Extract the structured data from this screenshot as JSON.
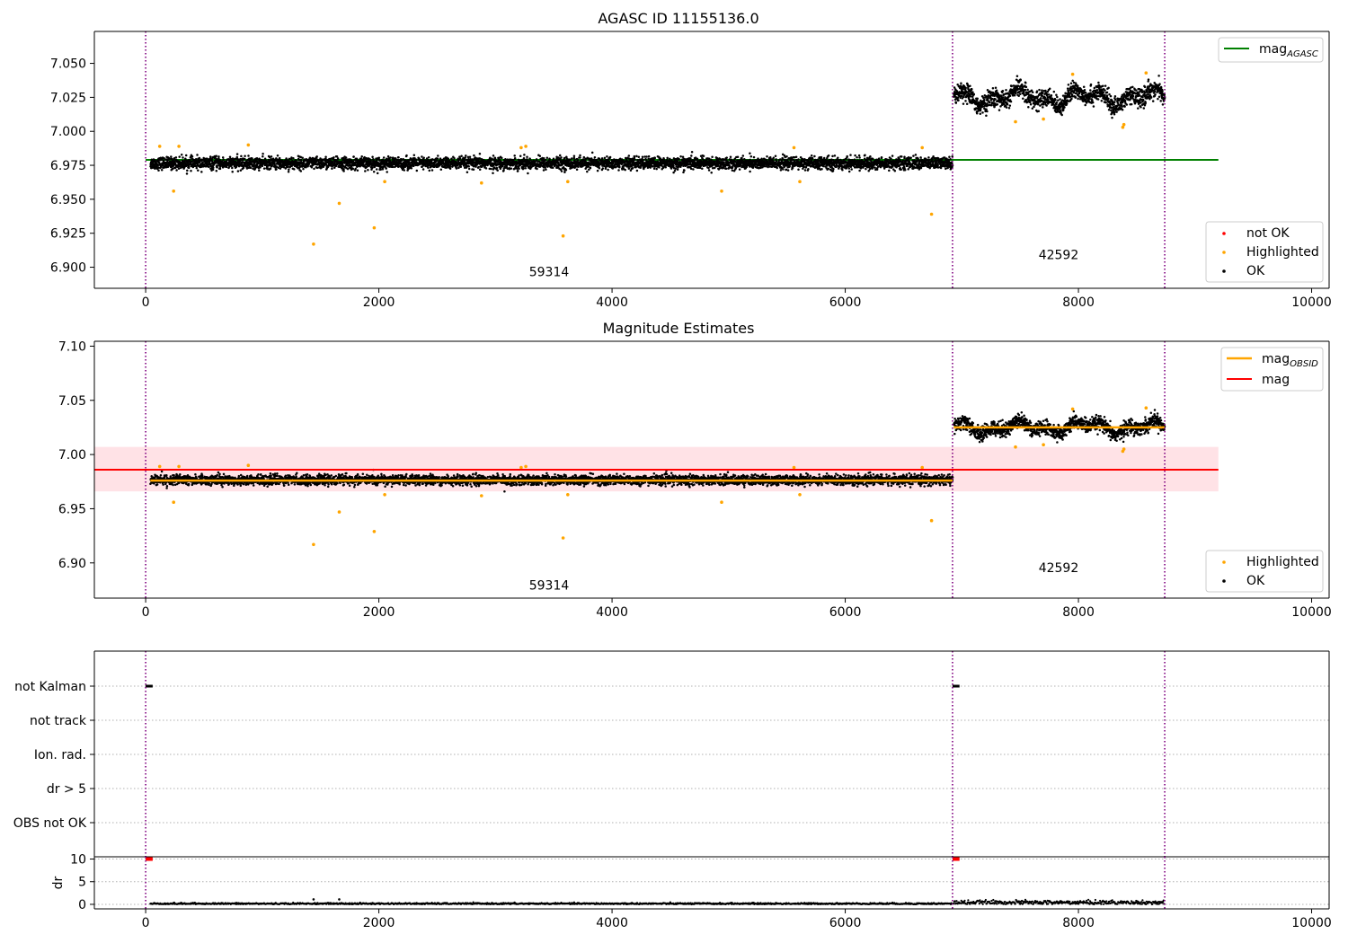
{
  "chart_data": [
    {
      "type": "scatter",
      "title": "AGASC ID 11155136.0",
      "xlim": [
        -440,
        10150
      ],
      "ylim": [
        6.8845,
        7.0735
      ],
      "xticks": [
        0,
        2000,
        4000,
        6000,
        8000,
        10000
      ],
      "yticks": [
        6.9,
        6.925,
        6.95,
        6.975,
        7.0,
        7.025,
        7.05
      ],
      "ytick_labels": [
        "6.900",
        "6.925",
        "6.950",
        "6.975",
        "7.000",
        "7.025",
        "7.050"
      ],
      "obs_boundaries": [
        0,
        6920,
        8740
      ],
      "obs_labels": [
        {
          "text": "59314",
          "x": 3460,
          "y": 6.8935
        },
        {
          "text": "42592",
          "x": 7830,
          "y": 6.906
        }
      ],
      "mag_agasc": {
        "value": 6.979,
        "x_range": [
          0,
          9200
        ]
      },
      "obs_segments": [
        {
          "x_start": 40,
          "x_end": 6920,
          "mean": 6.9765,
          "spread": 0.004
        },
        {
          "x_start": 6930,
          "x_end": 8740,
          "mean": 7.025,
          "spread": 0.006
        }
      ],
      "highlighted": [
        [
          120,
          6.989
        ],
        [
          240,
          6.956
        ],
        [
          285,
          6.989
        ],
        [
          880,
          6.99
        ],
        [
          1440,
          6.917
        ],
        [
          1660,
          6.947
        ],
        [
          1960,
          6.929
        ],
        [
          2050,
          6.963
        ],
        [
          2880,
          6.962
        ],
        [
          3220,
          6.988
        ],
        [
          3260,
          6.989
        ],
        [
          3580,
          6.923
        ],
        [
          3620,
          6.963
        ],
        [
          4940,
          6.956
        ],
        [
          5560,
          6.988
        ],
        [
          5610,
          6.963
        ],
        [
          6660,
          6.988
        ],
        [
          6740,
          6.939
        ],
        [
          7460,
          7.007
        ],
        [
          7700,
          7.009
        ],
        [
          7950,
          7.042
        ],
        [
          8380,
          7.003
        ],
        [
          8390,
          7.005
        ],
        [
          8580,
          7.043
        ]
      ],
      "legend_upper": [
        "mag_AGASC"
      ],
      "legend_lower": [
        "not OK",
        "Highlighted",
        "OK"
      ]
    },
    {
      "type": "scatter",
      "title": "Magnitude Estimates",
      "xlim": [
        -440,
        10150
      ],
      "ylim": [
        6.8675,
        7.1045
      ],
      "xticks": [
        0,
        2000,
        4000,
        6000,
        8000,
        10000
      ],
      "yticks": [
        6.9,
        6.95,
        7.0,
        7.05,
        7.1
      ],
      "ytick_labels": [
        "6.90",
        "6.95",
        "7.00",
        "7.05",
        "7.10"
      ],
      "obs_boundaries": [
        0,
        6920,
        8740
      ],
      "obs_labels": [
        {
          "text": "59314",
          "x": 3460,
          "y": 6.8755
        },
        {
          "text": "42592",
          "x": 7830,
          "y": 6.8915
        }
      ],
      "mag": {
        "value": 6.986,
        "band": [
          6.966,
          7.007
        ],
        "x_range": [
          -440,
          9200
        ]
      },
      "mag_obsid": [
        {
          "x_range": [
            40,
            6920
          ],
          "value": 6.976
        },
        {
          "x_range": [
            6930,
            8740
          ],
          "value": 7.025
        }
      ],
      "obs_segments": [
        {
          "x_start": 40,
          "x_end": 6920,
          "mean": 6.9765,
          "spread": 0.004
        },
        {
          "x_start": 6930,
          "x_end": 8740,
          "mean": 7.025,
          "spread": 0.006
        }
      ],
      "highlighted": [
        [
          120,
          6.989
        ],
        [
          240,
          6.956
        ],
        [
          285,
          6.989
        ],
        [
          880,
          6.99
        ],
        [
          1440,
          6.917
        ],
        [
          1660,
          6.947
        ],
        [
          1960,
          6.929
        ],
        [
          2050,
          6.963
        ],
        [
          2880,
          6.962
        ],
        [
          3220,
          6.988
        ],
        [
          3260,
          6.989
        ],
        [
          3580,
          6.923
        ],
        [
          3620,
          6.963
        ],
        [
          4940,
          6.956
        ],
        [
          5560,
          6.988
        ],
        [
          5610,
          6.963
        ],
        [
          6660,
          6.988
        ],
        [
          6740,
          6.939
        ],
        [
          7460,
          7.007
        ],
        [
          7700,
          7.009
        ],
        [
          7950,
          7.042
        ],
        [
          8380,
          7.003
        ],
        [
          8390,
          7.005
        ],
        [
          8580,
          7.043
        ]
      ],
      "legend_upper": [
        "mag_OBSID",
        "mag"
      ],
      "legend_lower": [
        "Highlighted",
        "OK"
      ]
    },
    {
      "type": "scatter",
      "title": "",
      "xlim": [
        -440,
        10150
      ],
      "flag_rows": [
        "not Kalman",
        "not track",
        "Ion. rad.",
        "dr > 5",
        "OBS not OK"
      ],
      "obs_boundaries": [
        0,
        6920,
        8740
      ],
      "flag_marks": [
        {
          "row": "not Kalman",
          "x_range": [
            0,
            60
          ]
        },
        {
          "row": "not Kalman",
          "x_range": [
            6920,
            6980
          ]
        }
      ]
    },
    {
      "type": "scatter",
      "title": "",
      "ylabel": "dr",
      "xlim": [
        -440,
        10150
      ],
      "ylim": [
        -1,
        10.5
      ],
      "xticks": [
        0,
        2000,
        4000,
        6000,
        8000,
        10000
      ],
      "yticks": [
        0,
        5,
        10
      ],
      "obs_boundaries": [
        0,
        6920,
        8740
      ],
      "dr_segments": [
        {
          "x_start": 40,
          "x_end": 6920,
          "mean": 0.15
        },
        {
          "x_start": 6930,
          "x_end": 8740,
          "mean": 0.4
        }
      ],
      "dr_outliers": [
        [
          1440,
          1.1
        ],
        [
          1660,
          1.1
        ]
      ],
      "dr_notok": [
        {
          "x_range": [
            0,
            60
          ],
          "value": 10
        },
        {
          "x_range": [
            6920,
            6980
          ],
          "value": 10
        }
      ]
    }
  ],
  "legend_labels": {
    "mag_agasc_base": "mag",
    "mag_agasc_sub": "AGASC",
    "mag_obsid_base": "mag",
    "mag_obsid_sub": "OBSID",
    "mag": "mag",
    "not_ok": "not OK",
    "highlighted": "Highlighted",
    "ok": "OK"
  },
  "colors": {
    "ok": "#000000",
    "highlighted": "#ffa500",
    "not_ok": "#ff0000",
    "mag_agasc": "#008000",
    "mag_obsid": "#ffa500",
    "mag": "#ff0000",
    "mag_band": "#ffb6c1",
    "boundary": "#800080",
    "grid": "#b0b0b0"
  }
}
